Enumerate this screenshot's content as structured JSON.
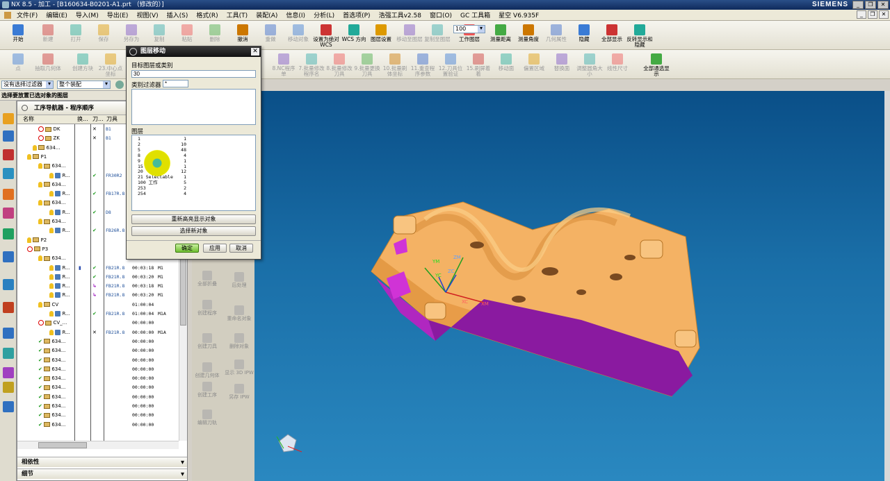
{
  "window": {
    "title": "NX 8.5 - 加工 - [B160634-B0201-A1.prt （修改的）]",
    "brand": "SIEMENS"
  },
  "menu": [
    "文件(F)",
    "编辑(E)",
    "导入(M)",
    "导出(E)",
    "视图(V)",
    "插入(S)",
    "格式(R)",
    "工具(T)",
    "装配(A)",
    "信息(I)",
    "分析(L)",
    "首选项(P)",
    "浩强工具v2.58",
    "窗口(O)",
    "GC 工具箱",
    "星空 V6.935F"
  ],
  "toolbar1": [
    {
      "label": "开始",
      "enabled": true
    },
    {
      "label": "新建",
      "enabled": false
    },
    {
      "label": "打开",
      "enabled": false
    },
    {
      "label": "保存",
      "enabled": false
    },
    {
      "label": "另存为",
      "enabled": false
    },
    {
      "label": "复制",
      "enabled": false
    },
    {
      "label": "粘贴",
      "enabled": false
    },
    {
      "label": "删除",
      "enabled": false
    },
    {
      "label": "撤消",
      "enabled": true
    },
    {
      "label": "重做",
      "enabled": false
    },
    {
      "label": "移动对象",
      "enabled": false
    },
    {
      "label": "设置为绝对 WCS",
      "enabled": true
    },
    {
      "label": "WCS 方向",
      "enabled": true
    },
    {
      "label": "图层设置",
      "enabled": true
    },
    {
      "label": "移动至图层",
      "enabled": false
    },
    {
      "label": "复制至图层",
      "enabled": false
    },
    {
      "label": "工作图层",
      "enabled": true
    },
    {
      "label": "测量距离",
      "enabled": true
    },
    {
      "label": "测量角度",
      "enabled": true
    },
    {
      "label": "几何属性",
      "enabled": false
    },
    {
      "label": "隐藏",
      "enabled": true
    },
    {
      "label": "全部显示",
      "enabled": true
    },
    {
      "label": "反转显示和隐藏",
      "enabled": true
    }
  ],
  "zoom_value": "100",
  "toolbar2": [
    {
      "label": "点",
      "enabled": false
    },
    {
      "label": "抽取几何体",
      "enabled": false
    },
    {
      "label": "创建方块",
      "enabled": false
    },
    {
      "label": "23.中心点坐标",
      "enabled": false
    },
    {
      "label": "8.NC程序单",
      "enabled": false
    },
    {
      "label": "7.批量修改程序名",
      "enabled": false
    },
    {
      "label": "8.批量修改刀具",
      "enabled": false
    },
    {
      "label": "9.批量更换刀具",
      "enabled": false
    },
    {
      "label": "10.批量刷体坐标",
      "enabled": false
    },
    {
      "label": "11.重查程序参数",
      "enabled": false
    },
    {
      "label": "12.刀具位置验证",
      "enabled": false
    },
    {
      "label": "15.刷屏着着",
      "enabled": false
    },
    {
      "label": "移动面",
      "enabled": false
    },
    {
      "label": "偏置区域",
      "enabled": false
    },
    {
      "label": "替换面",
      "enabled": false
    },
    {
      "label": "调整圆角大小",
      "enabled": false
    },
    {
      "label": "线性尺寸",
      "enabled": false
    },
    {
      "label": "全部通选显示",
      "enabled": true
    }
  ],
  "filter": {
    "type": "没有选择过滤器",
    "scope": "整个装配"
  },
  "status": "选择要放置已选对象的图层",
  "navigator": {
    "title": "工序导航器 - 程序顺序",
    "columns": [
      "名称",
      "换...",
      "刀...",
      "刀具"
    ],
    "rows": [
      {
        "name": "DK",
        "c2": "",
        "c3": "✕",
        "tool": "B1",
        "time": "",
        "extra": ""
      },
      {
        "name": "ZK",
        "c2": "",
        "c3": "✕",
        "tool": "B1",
        "time": "",
        "extra": ""
      },
      {
        "name": "634...",
        "c2": "",
        "c3": "",
        "tool": "",
        "time": "",
        "extra": ""
      },
      {
        "name": "P1",
        "c2": "",
        "c3": "",
        "tool": "",
        "time": "",
        "extra": ""
      },
      {
        "name": "634...",
        "c2": "",
        "c3": "",
        "tool": "",
        "time": "",
        "extra": ""
      },
      {
        "name": "R...",
        "c2": "",
        "c3": "✔",
        "tool": "FR30R2",
        "time": "",
        "extra": ""
      },
      {
        "name": "634...",
        "c2": "",
        "c3": "",
        "tool": "",
        "time": "",
        "extra": ""
      },
      {
        "name": "R...",
        "c2": "",
        "c3": "✔",
        "tool": "FB17R.8",
        "time": "",
        "extra": ""
      },
      {
        "name": "634...",
        "c2": "",
        "c3": "",
        "tool": "",
        "time": "",
        "extra": ""
      },
      {
        "name": "R...",
        "c2": "",
        "c3": "✔",
        "tool": "D8",
        "time": "",
        "extra": ""
      },
      {
        "name": "634...",
        "c2": "",
        "c3": "",
        "tool": "",
        "time": "",
        "extra": ""
      },
      {
        "name": "R...",
        "c2": "",
        "c3": "✔",
        "tool": "FB26R.8",
        "time": "",
        "extra": ""
      },
      {
        "name": "P2",
        "c2": "",
        "c3": "",
        "tool": "",
        "time": "",
        "extra": ""
      },
      {
        "name": "P3",
        "c2": "",
        "c3": "",
        "tool": "",
        "time": "",
        "extra": ""
      },
      {
        "name": "634...",
        "c2": "",
        "c3": "",
        "tool": "",
        "time": "",
        "extra": ""
      },
      {
        "name": "R...",
        "c2": "▮",
        "c3": "✔",
        "tool": "FB21R.8",
        "time": "00:03:18",
        "extra": "M1"
      },
      {
        "name": "R...",
        "c2": "",
        "c3": "✔",
        "tool": "FB21R.8",
        "time": "00:03:20",
        "extra": "M1"
      },
      {
        "name": "R...",
        "c2": "",
        "c3": "↳",
        "tool": "FB21R.8",
        "time": "00:03:18",
        "extra": "M1"
      },
      {
        "name": "R...",
        "c2": "",
        "c3": "↳",
        "tool": "FB21R.8",
        "time": "00:03:20",
        "extra": "M1"
      },
      {
        "name": "CV",
        "c2": "",
        "c3": "",
        "tool": "",
        "time": "01:00:04",
        "extra": ""
      },
      {
        "name": "R...",
        "c2": "",
        "c3": "✔",
        "tool": "FB21R.8",
        "time": "01:00:04",
        "extra": "M1A"
      },
      {
        "name": "CV_...",
        "c2": "",
        "c3": "",
        "tool": "",
        "time": "00:00:00",
        "extra": ""
      },
      {
        "name": "R...",
        "c2": "",
        "c3": "✕",
        "tool": "FB21R.8",
        "time": "00:00:00",
        "extra": "M1A"
      },
      {
        "name": "634...",
        "c2": "",
        "c3": "",
        "tool": "",
        "time": "00:00:00",
        "extra": ""
      },
      {
        "name": "634...",
        "c2": "",
        "c3": "",
        "tool": "",
        "time": "00:00:00",
        "extra": ""
      },
      {
        "name": "634...",
        "c2": "",
        "c3": "",
        "tool": "",
        "time": "00:00:00",
        "extra": ""
      },
      {
        "name": "634...",
        "c2": "",
        "c3": "",
        "tool": "",
        "time": "00:00:00",
        "extra": ""
      },
      {
        "name": "634...",
        "c2": "",
        "c3": "",
        "tool": "",
        "time": "00:00:00",
        "extra": ""
      },
      {
        "name": "634...",
        "c2": "",
        "c3": "",
        "tool": "",
        "time": "00:00:00",
        "extra": ""
      },
      {
        "name": "634...",
        "c2": "",
        "c3": "",
        "tool": "",
        "time": "00:00:00",
        "extra": ""
      },
      {
        "name": "634...",
        "c2": "",
        "c3": "",
        "tool": "",
        "time": "00:00:00",
        "extra": ""
      },
      {
        "name": "634...",
        "c2": "",
        "c3": "",
        "tool": "",
        "time": "00:00:00",
        "extra": ""
      },
      {
        "name": "634...",
        "c2": "",
        "c3": "",
        "tool": "",
        "time": "00:00:00",
        "extra": ""
      }
    ],
    "dependency": "相依性",
    "details": "细节"
  },
  "side_tools": [
    "全部折叠",
    "后处理",
    "创建程序",
    "重命名对象",
    "创建刀具",
    "删除对象",
    "创建几何体",
    "显示 3D IPW",
    "创建工序",
    "另存 IPW",
    "编辑刀轨"
  ],
  "dialog": {
    "title": "图层移动",
    "target_label": "目标图层或类别",
    "target_value": "30",
    "filter_label": "类别过滤器",
    "filter_value": "*",
    "layers_label": "图层",
    "layers": [
      [
        "1",
        "1"
      ],
      [
        "2",
        "10"
      ],
      [
        "5",
        "48"
      ],
      [
        "8",
        "4"
      ],
      [
        "9",
        "1"
      ],
      [
        "15",
        "1"
      ],
      [
        "20",
        "12"
      ],
      [
        "21 Selectable",
        "1"
      ],
      [
        "100 工作",
        "5"
      ],
      [
        "253",
        "2"
      ],
      [
        "254",
        "4"
      ]
    ],
    "btn_rehighlight": "重新高亮显示对象",
    "btn_select_new": "选择新对象",
    "btn_ok": "确定",
    "btn_apply": "应用",
    "btn_cancel": "取消"
  },
  "viewport": {
    "axis_labels": [
      "YM",
      "ZM",
      "XM",
      "YC",
      "ZC",
      "XC"
    ],
    "part_color": "#f5b15a",
    "accent_color": "#a020c8"
  }
}
